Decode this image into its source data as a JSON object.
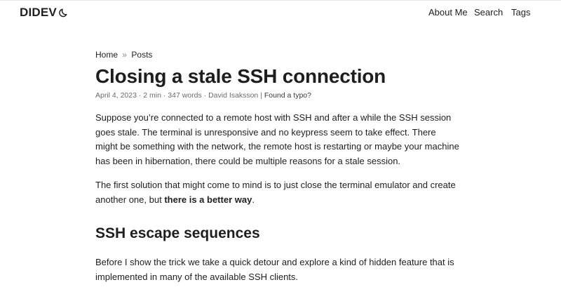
{
  "header": {
    "logo": "DIDEV",
    "theme_icon": "moon-icon",
    "nav": [
      "About Me",
      "Search",
      "Tags"
    ]
  },
  "breadcrumb": {
    "home": "Home",
    "separator": "»",
    "posts": "Posts"
  },
  "post": {
    "title": "Closing a stale SSH connection",
    "meta": "April 4, 2023 · 2 min · 347 words · David Isaksson",
    "meta_separator": " | ",
    "typo_link": "Found a typo?",
    "paragraph1": "Suppose you’re connected to a remote host with SSH and after a while the SSH session goes stale. The terminal is unresponsive and no keypress seem to take effect. There might be something with the network, the remote host is restarting or maybe your machine has been in hibernation, there could be multiple reasons for a stale session.",
    "paragraph2_before": "The first solution that might come to mind is to just close the terminal emulator and create another one, but ",
    "paragraph2_bold": "there is a better way",
    "paragraph2_after": ".",
    "heading": "SSH escape sequences",
    "paragraph3": "Before I show the trick we take a quick detour and explore a kind of hidden feature that is implemented in many of the available SSH clients."
  }
}
